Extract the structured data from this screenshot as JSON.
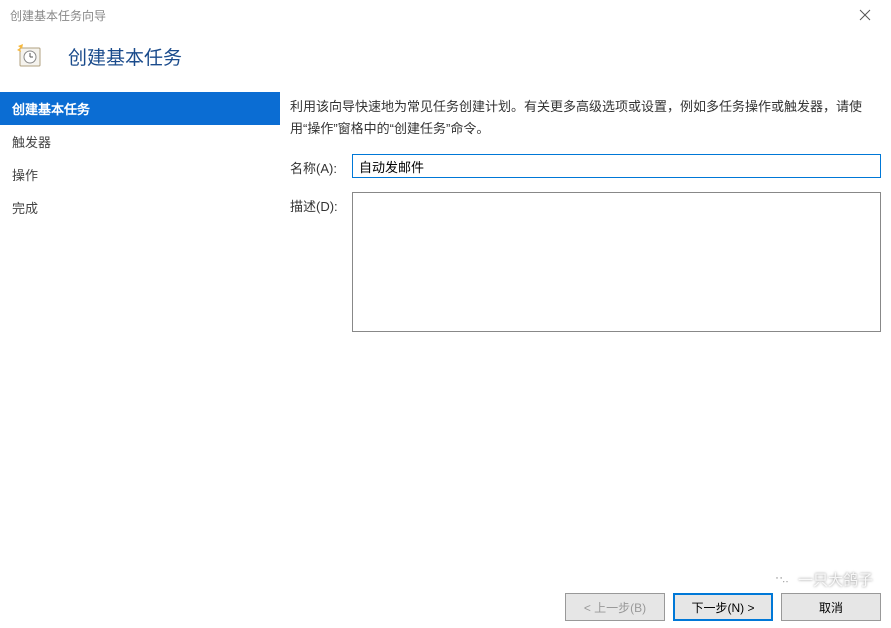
{
  "window": {
    "title": "创建基本任务向导"
  },
  "header": {
    "title": "创建基本任务"
  },
  "sidebar": {
    "items": [
      {
        "label": "创建基本任务",
        "selected": true
      },
      {
        "label": "触发器",
        "selected": false
      },
      {
        "label": "操作",
        "selected": false
      },
      {
        "label": "完成",
        "selected": false
      }
    ]
  },
  "main": {
    "intro": "利用该向导快速地为常见任务创建计划。有关更多高级选项或设置，例如多任务操作或触发器，请使用“操作”窗格中的“创建任务”命令。",
    "name_label": "名称(A):",
    "name_value": "自动发邮件",
    "desc_label": "描述(D):",
    "desc_value": ""
  },
  "footer": {
    "back": "< 上一步(B)",
    "next": "下一步(N) >",
    "cancel": "取消"
  },
  "watermark": {
    "text": "一只大鸽子"
  }
}
